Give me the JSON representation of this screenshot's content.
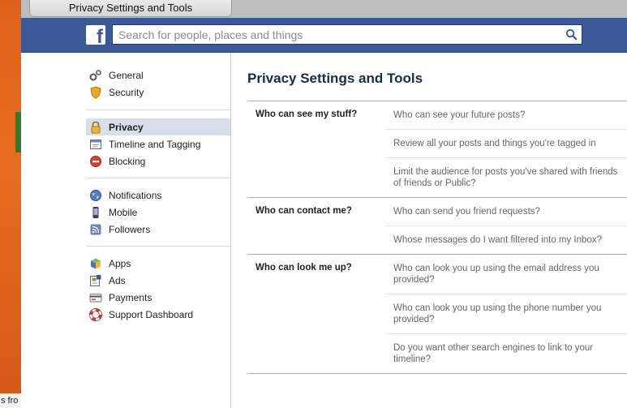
{
  "browser": {
    "tab_title": "Privacy Settings and Tools"
  },
  "desktop": {
    "partial_text": "s fro"
  },
  "header": {
    "logo": "f",
    "search_placeholder": "Search for people, places and things"
  },
  "sidebar": {
    "groups": [
      [
        {
          "label": "General",
          "icon": "gears-icon"
        },
        {
          "label": "Security",
          "icon": "badge-icon"
        }
      ],
      [
        {
          "label": "Privacy",
          "icon": "lock-icon",
          "active": true
        },
        {
          "label": "Timeline and Tagging",
          "icon": "timeline-icon"
        },
        {
          "label": "Blocking",
          "icon": "block-icon"
        }
      ],
      [
        {
          "label": "Notifications",
          "icon": "globe-icon"
        },
        {
          "label": "Mobile",
          "icon": "phone-icon"
        },
        {
          "label": "Followers",
          "icon": "rss-icon"
        }
      ],
      [
        {
          "label": "Apps",
          "icon": "cube-icon"
        },
        {
          "label": "Ads",
          "icon": "ads-icon"
        },
        {
          "label": "Payments",
          "icon": "card-icon"
        },
        {
          "label": "Support Dashboard",
          "icon": "lifebuoy-icon"
        }
      ]
    ]
  },
  "main": {
    "title": "Privacy Settings and Tools",
    "sections": [
      {
        "label": "Who can see my stuff?",
        "rows": [
          "Who can see your future posts?",
          "Review all your posts and things you're tagged in",
          "Limit the audience for posts you've shared with friends of friends or Public?"
        ]
      },
      {
        "label": "Who can contact me?",
        "rows": [
          "Who can send you friend requests?",
          "Whose messages do I want filtered into my Inbox?"
        ]
      },
      {
        "label": "Who can look me up?",
        "rows": [
          "Who can look you up using the email address you provided?",
          "Who can look you up using the phone number you provided?",
          "Do you want other search engines to link to your timeline?"
        ]
      }
    ]
  },
  "colors": {
    "brand": "#3b5998",
    "active_bg": "#d8dfea"
  }
}
